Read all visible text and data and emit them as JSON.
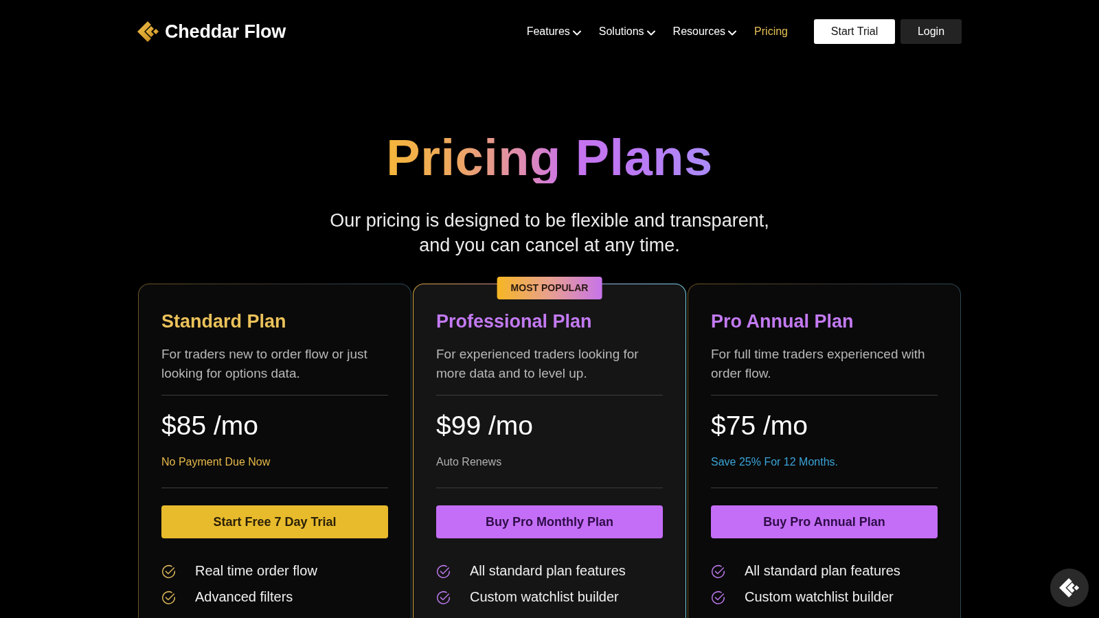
{
  "header": {
    "logo": "Cheddar Flow",
    "nav": [
      {
        "label": "Features",
        "dropdown": true,
        "selected": false
      },
      {
        "label": "Solutions",
        "dropdown": true,
        "selected": false
      },
      {
        "label": "Resources",
        "dropdown": true,
        "selected": false
      },
      {
        "label": "Pricing",
        "dropdown": false,
        "selected": true
      }
    ],
    "buttons": [
      {
        "label": "Start Trial",
        "kind": "primary"
      },
      {
        "label": "Login",
        "kind": "secondary"
      }
    ]
  },
  "hero": {
    "title": "Pricing Plans",
    "subtitle": "Our pricing is designed to be flexible and transparent, and you can cancel at any time."
  },
  "plans": [
    {
      "kind": "standard",
      "featured": false,
      "name": "Standard Plan",
      "description": "For traders new to order flow or just looking for options data.",
      "price": "$85 /mo",
      "note": "No Payment Due Now",
      "button": "Start Free 7 Day Trial",
      "features": [
        "Real time order flow",
        "Advanced filters"
      ]
    },
    {
      "kind": "monthly",
      "featured": true,
      "badge": "MOST POPULAR",
      "name": "Professional Plan",
      "description": "For experienced traders looking for more data and to level up.",
      "price": "$99 /mo",
      "note": "Auto Renews",
      "button": "Buy Pro Monthly Plan",
      "features": [
        "All standard plan features",
        "Custom watchlist builder"
      ]
    },
    {
      "kind": "annual",
      "featured": false,
      "name": "Pro Annual Plan",
      "description": "For full time traders experienced with order flow.",
      "price": "$75 /mo",
      "note": "Save 25% For 12 Months.",
      "button": "Buy Pro Annual Plan",
      "features": [
        "All standard plan features",
        "Custom watchlist builder"
      ]
    }
  ]
}
